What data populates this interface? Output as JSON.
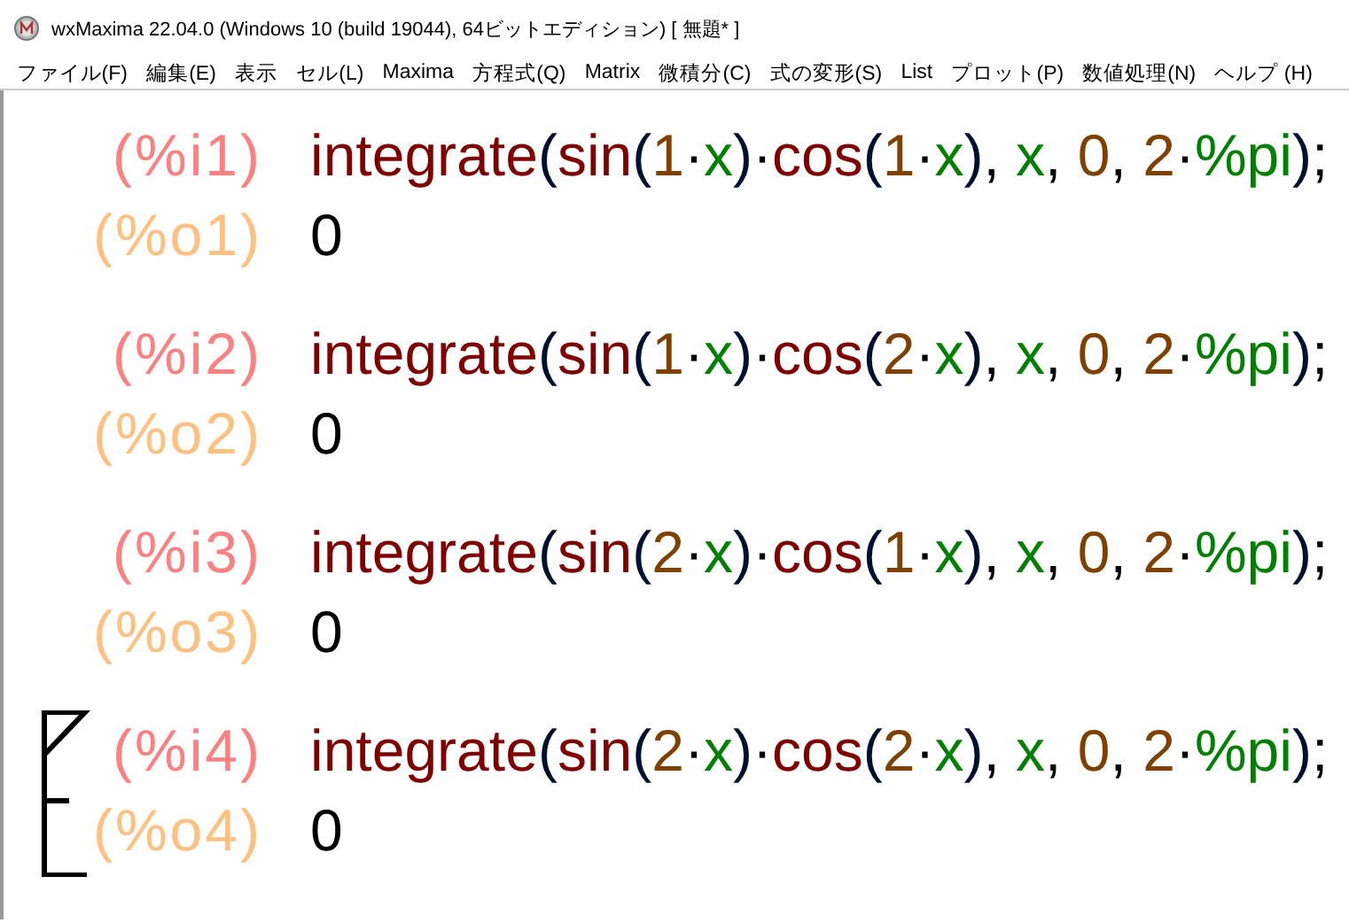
{
  "window": {
    "title": "wxMaxima 22.04.0 (Windows 10 (build 19044), 64ビットエディション) [ 無題* ]"
  },
  "menu": [
    "ファイル(F)",
    "編集(E)",
    "表示",
    "セル(L)",
    "Maxima",
    "方程式(Q)",
    "Matrix",
    "微積分(C)",
    "式の変形(S)",
    "List",
    "プロット(P)",
    "数値処理(N)",
    "ヘルプ (H)"
  ],
  "cells": [
    {
      "input_label": "(%i1)",
      "selected": false,
      "input": [
        {
          "kind": "fn",
          "text": "integrate"
        },
        {
          "kind": "paren",
          "text": "("
        },
        {
          "kind": "fn",
          "text": "sin"
        },
        {
          "kind": "paren",
          "text": "("
        },
        {
          "kind": "num",
          "text": "1"
        },
        {
          "kind": "op",
          "text": "·"
        },
        {
          "kind": "var",
          "text": "x"
        },
        {
          "kind": "paren",
          "text": ")"
        },
        {
          "kind": "op",
          "text": "·"
        },
        {
          "kind": "fn",
          "text": "cos"
        },
        {
          "kind": "paren",
          "text": "("
        },
        {
          "kind": "num",
          "text": "1"
        },
        {
          "kind": "op",
          "text": "·"
        },
        {
          "kind": "var",
          "text": "x"
        },
        {
          "kind": "paren",
          "text": ")"
        },
        {
          "kind": "op",
          "text": ", "
        },
        {
          "kind": "var",
          "text": "x"
        },
        {
          "kind": "op",
          "text": ", "
        },
        {
          "kind": "num",
          "text": "0"
        },
        {
          "kind": "op",
          "text": ", "
        },
        {
          "kind": "num",
          "text": "2"
        },
        {
          "kind": "op",
          "text": "·"
        },
        {
          "kind": "var",
          "text": "%pi"
        },
        {
          "kind": "paren",
          "text": ")"
        },
        {
          "kind": "op",
          "text": ";"
        }
      ],
      "output_label": "(%o1)",
      "output": "0"
    },
    {
      "input_label": "(%i2)",
      "selected": false,
      "input": [
        {
          "kind": "fn",
          "text": "integrate"
        },
        {
          "kind": "paren",
          "text": "("
        },
        {
          "kind": "fn",
          "text": "sin"
        },
        {
          "kind": "paren",
          "text": "("
        },
        {
          "kind": "num",
          "text": "1"
        },
        {
          "kind": "op",
          "text": "·"
        },
        {
          "kind": "var",
          "text": "x"
        },
        {
          "kind": "paren",
          "text": ")"
        },
        {
          "kind": "op",
          "text": "·"
        },
        {
          "kind": "fn",
          "text": "cos"
        },
        {
          "kind": "paren",
          "text": "("
        },
        {
          "kind": "num",
          "text": "2"
        },
        {
          "kind": "op",
          "text": "·"
        },
        {
          "kind": "var",
          "text": "x"
        },
        {
          "kind": "paren",
          "text": ")"
        },
        {
          "kind": "op",
          "text": ", "
        },
        {
          "kind": "var",
          "text": "x"
        },
        {
          "kind": "op",
          "text": ", "
        },
        {
          "kind": "num",
          "text": "0"
        },
        {
          "kind": "op",
          "text": ", "
        },
        {
          "kind": "num",
          "text": "2"
        },
        {
          "kind": "op",
          "text": "·"
        },
        {
          "kind": "var",
          "text": "%pi"
        },
        {
          "kind": "paren",
          "text": ")"
        },
        {
          "kind": "op",
          "text": ";"
        }
      ],
      "output_label": "(%o2)",
      "output": "0"
    },
    {
      "input_label": "(%i3)",
      "selected": false,
      "input": [
        {
          "kind": "fn",
          "text": "integrate"
        },
        {
          "kind": "paren",
          "text": "("
        },
        {
          "kind": "fn",
          "text": "sin"
        },
        {
          "kind": "paren",
          "text": "("
        },
        {
          "kind": "num",
          "text": "2"
        },
        {
          "kind": "op",
          "text": "·"
        },
        {
          "kind": "var",
          "text": "x"
        },
        {
          "kind": "paren",
          "text": ")"
        },
        {
          "kind": "op",
          "text": "·"
        },
        {
          "kind": "fn",
          "text": "cos"
        },
        {
          "kind": "paren",
          "text": "("
        },
        {
          "kind": "num",
          "text": "1"
        },
        {
          "kind": "op",
          "text": "·"
        },
        {
          "kind": "var",
          "text": "x"
        },
        {
          "kind": "paren",
          "text": ")"
        },
        {
          "kind": "op",
          "text": ", "
        },
        {
          "kind": "var",
          "text": "x"
        },
        {
          "kind": "op",
          "text": ", "
        },
        {
          "kind": "num",
          "text": "0"
        },
        {
          "kind": "op",
          "text": ", "
        },
        {
          "kind": "num",
          "text": "2"
        },
        {
          "kind": "op",
          "text": "·"
        },
        {
          "kind": "var",
          "text": "%pi"
        },
        {
          "kind": "paren",
          "text": ")"
        },
        {
          "kind": "op",
          "text": ";"
        }
      ],
      "output_label": "(%o3)",
      "output": "0"
    },
    {
      "input_label": "(%i4)",
      "selected": true,
      "input": [
        {
          "kind": "fn",
          "text": "integrate"
        },
        {
          "kind": "paren",
          "text": "("
        },
        {
          "kind": "fn",
          "text": "sin"
        },
        {
          "kind": "paren",
          "text": "("
        },
        {
          "kind": "num",
          "text": "2"
        },
        {
          "kind": "op",
          "text": "·"
        },
        {
          "kind": "var",
          "text": "x"
        },
        {
          "kind": "paren",
          "text": ")"
        },
        {
          "kind": "op",
          "text": "·"
        },
        {
          "kind": "fn",
          "text": "cos"
        },
        {
          "kind": "paren",
          "text": "("
        },
        {
          "kind": "num",
          "text": "2"
        },
        {
          "kind": "op",
          "text": "·"
        },
        {
          "kind": "var",
          "text": "x"
        },
        {
          "kind": "paren",
          "text": ")"
        },
        {
          "kind": "op",
          "text": ", "
        },
        {
          "kind": "var",
          "text": "x"
        },
        {
          "kind": "op",
          "text": ", "
        },
        {
          "kind": "num",
          "text": "0"
        },
        {
          "kind": "op",
          "text": ", "
        },
        {
          "kind": "num",
          "text": "2"
        },
        {
          "kind": "op",
          "text": "·"
        },
        {
          "kind": "var",
          "text": "%pi"
        },
        {
          "kind": "paren",
          "text": ")"
        },
        {
          "kind": "op",
          "text": ";"
        }
      ],
      "output_label": "(%o4)",
      "output": "0"
    }
  ]
}
